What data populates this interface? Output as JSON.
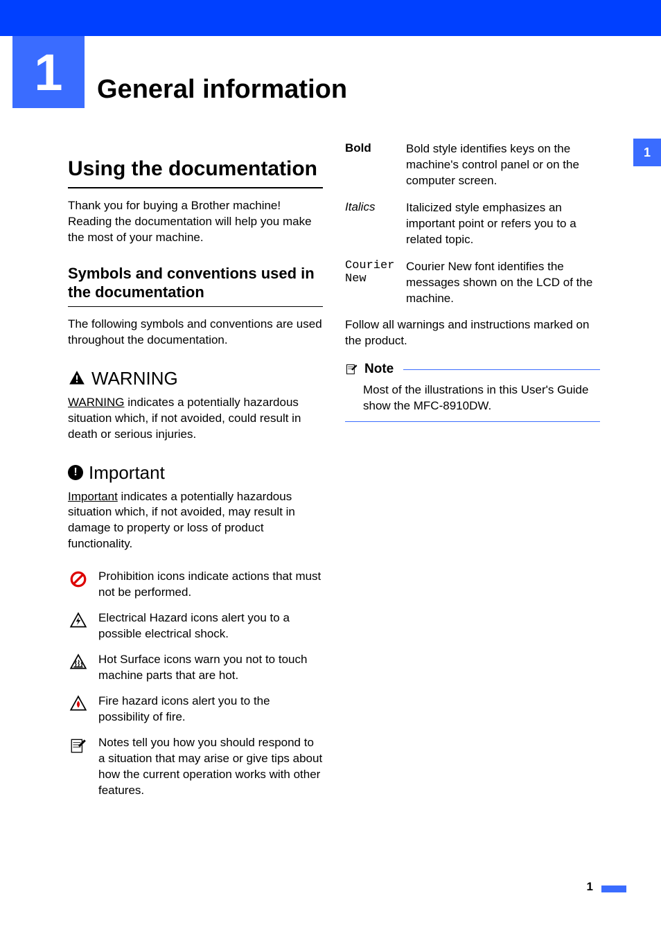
{
  "chapter": {
    "number": "1",
    "title": "General information"
  },
  "tab": {
    "number": "1"
  },
  "left": {
    "h1": "Using the documentation",
    "intro": "Thank you for buying a Brother machine! Reading the documentation will help you make the most of your machine.",
    "h2": "Symbols and conventions used in the documentation",
    "intro2": "The following symbols and conventions are used throughout the documentation.",
    "warning": {
      "head": "WARNING",
      "underlined": "WARNING",
      "rest": " indicates a potentially hazardous situation which, if not avoided, could result in death or serious injuries."
    },
    "important": {
      "head": "Important",
      "underlined": "Important",
      "rest": " indicates a potentially hazardous situation which, if not avoided, may result in damage to property or loss of product functionality."
    },
    "icons": {
      "prohibition": "Prohibition icons indicate actions that must not be performed.",
      "electrical": "Electrical Hazard icons alert you to a possible electrical shock.",
      "hot": "Hot Surface icons warn you not to touch machine parts that are hot.",
      "fire": "Fire hazard icons alert you to the possibility of fire.",
      "note": "Notes tell you how you should respond to a situation that may arise or give tips about how the current operation works with other features."
    }
  },
  "right": {
    "styles": {
      "bold": {
        "label": "Bold",
        "desc": "Bold style identifies keys on the machine's control panel or on the computer screen."
      },
      "italics": {
        "label": "Italics",
        "desc": "Italicized style emphasizes an important point or refers you to a related topic."
      },
      "courier": {
        "label": "Courier New",
        "desc": "Courier New font identifies the messages shown on the LCD of the machine."
      }
    },
    "follow": "Follow all warnings and instructions marked on the product.",
    "note": {
      "head": "Note",
      "body": "Most of the illustrations in this User's Guide show the MFC-8910DW."
    }
  },
  "footer": {
    "page": "1"
  }
}
